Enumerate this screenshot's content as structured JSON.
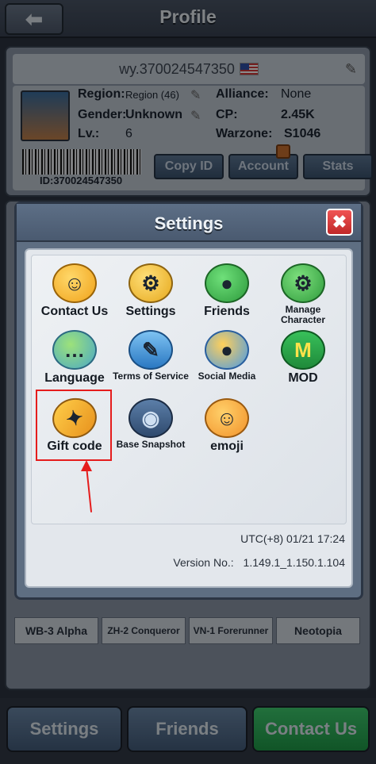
{
  "header": {
    "back_icon": "back-arrow-icon",
    "title": "Profile"
  },
  "profile": {
    "username": "wy.370024547350",
    "region_label": "Region:",
    "region_value": "Region (46)",
    "gender_label": "Gender:",
    "gender_value": "Unknown",
    "level_label": "Lv.:",
    "level_value": "6",
    "alliance_label": "Alliance:",
    "alliance_value": "None",
    "cp_label": "CP:",
    "cp_value": "2.45K",
    "warzone_label": "Warzone:",
    "warzone_value": "S1046",
    "id_text": "ID:370024547350",
    "buttons": {
      "copy_id": "Copy ID",
      "account": "Account",
      "stats": "Stats"
    }
  },
  "background_units": [
    "WB-3 Alpha",
    "ZH-2 Conqueror",
    "VN-1 Forerunner",
    "Neotopia"
  ],
  "modal": {
    "title": "Settings",
    "close_icon": "close-icon",
    "items": [
      {
        "label": "Contact Us",
        "icon": "headset-face-icon"
      },
      {
        "label": "Settings",
        "icon": "gears-icon"
      },
      {
        "label": "Friends",
        "icon": "people-icon"
      },
      {
        "label": "Manage Character",
        "icon": "person-gear-icon"
      },
      {
        "label": "Language",
        "icon": "speech-bubbles-icon"
      },
      {
        "label": "Terms of Service",
        "icon": "document-quill-icon"
      },
      {
        "label": "Social Media",
        "icon": "social-people-icon"
      },
      {
        "label": "MOD",
        "icon": "mod-m-icon",
        "glyph": "M"
      },
      {
        "label": "Gift code",
        "icon": "gift-ticket-icon"
      },
      {
        "label": "Base Snapshot",
        "icon": "camera-icon"
      },
      {
        "label": "emoji",
        "icon": "emoji-face-icon"
      }
    ],
    "utc": "UTC(+8) 01/21 17:24",
    "version_label": "Version No.:",
    "version_value": "1.149.1_1.150.1.104"
  },
  "bottom_bar": {
    "settings": "Settings",
    "friends": "Friends",
    "contact": "Contact Us"
  },
  "colors": {
    "highlight": "#e51c1c",
    "contact_green": "#2fb35a",
    "close_red": "#d93636"
  }
}
